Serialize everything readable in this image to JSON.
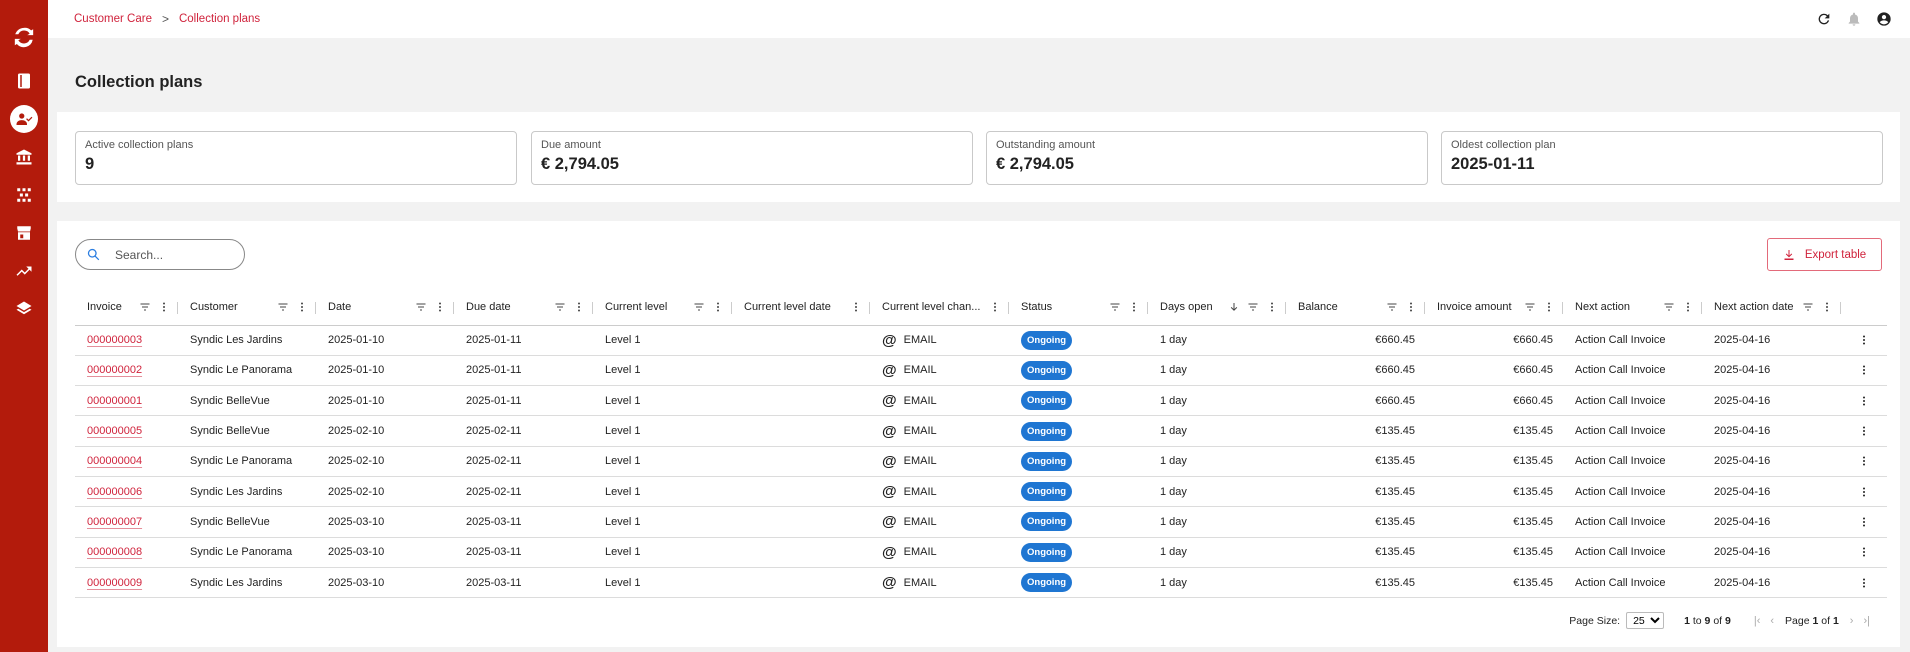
{
  "breadcrumb": {
    "parent": "Customer Care",
    "separator": ">",
    "current": "Collection plans"
  },
  "page": {
    "title": "Collection plans"
  },
  "kpis": [
    {
      "label": "Active collection plans",
      "value": "9"
    },
    {
      "label": "Due amount",
      "value": "€ 2,794.05"
    },
    {
      "label": "Outstanding amount",
      "value": "€ 2,794.05"
    },
    {
      "label": "Oldest collection plan",
      "value": "2025-01-11"
    }
  ],
  "search": {
    "placeholder": "Search..."
  },
  "export": {
    "label": "Export table"
  },
  "table": {
    "headers": [
      "Invoice",
      "Customer",
      "Date",
      "Due date",
      "Current level",
      "Current level date",
      "Current level chan...",
      "Status",
      "Days open",
      "Balance",
      "Invoice amount",
      "Next action",
      "Next action date"
    ],
    "rows": [
      {
        "invoice": "000000003",
        "customer": "Syndic Les Jardins",
        "date": "2025-01-10",
        "due": "2025-01-11",
        "level": "Level 1",
        "level_date": "",
        "channel": "EMAIL",
        "status": "Ongoing",
        "days": "1 day",
        "balance": "€660.45",
        "amount": "€660.45",
        "next_action": "Action Call Invoice",
        "next_date": "2025-04-16"
      },
      {
        "invoice": "000000002",
        "customer": "Syndic Le Panorama",
        "date": "2025-01-10",
        "due": "2025-01-11",
        "level": "Level 1",
        "level_date": "",
        "channel": "EMAIL",
        "status": "Ongoing",
        "days": "1 day",
        "balance": "€660.45",
        "amount": "€660.45",
        "next_action": "Action Call Invoice",
        "next_date": "2025-04-16"
      },
      {
        "invoice": "000000001",
        "customer": "Syndic BelleVue",
        "date": "2025-01-10",
        "due": "2025-01-11",
        "level": "Level 1",
        "level_date": "",
        "channel": "EMAIL",
        "status": "Ongoing",
        "days": "1 day",
        "balance": "€660.45",
        "amount": "€660.45",
        "next_action": "Action Call Invoice",
        "next_date": "2025-04-16"
      },
      {
        "invoice": "000000005",
        "customer": "Syndic BelleVue",
        "date": "2025-02-10",
        "due": "2025-02-11",
        "level": "Level 1",
        "level_date": "",
        "channel": "EMAIL",
        "status": "Ongoing",
        "days": "1 day",
        "balance": "€135.45",
        "amount": "€135.45",
        "next_action": "Action Call Invoice",
        "next_date": "2025-04-16"
      },
      {
        "invoice": "000000004",
        "customer": "Syndic Le Panorama",
        "date": "2025-02-10",
        "due": "2025-02-11",
        "level": "Level 1",
        "level_date": "",
        "channel": "EMAIL",
        "status": "Ongoing",
        "days": "1 day",
        "balance": "€135.45",
        "amount": "€135.45",
        "next_action": "Action Call Invoice",
        "next_date": "2025-04-16"
      },
      {
        "invoice": "000000006",
        "customer": "Syndic Les Jardins",
        "date": "2025-02-10",
        "due": "2025-02-11",
        "level": "Level 1",
        "level_date": "",
        "channel": "EMAIL",
        "status": "Ongoing",
        "days": "1 day",
        "balance": "€135.45",
        "amount": "€135.45",
        "next_action": "Action Call Invoice",
        "next_date": "2025-04-16"
      },
      {
        "invoice": "000000007",
        "customer": "Syndic BelleVue",
        "date": "2025-03-10",
        "due": "2025-03-11",
        "level": "Level 1",
        "level_date": "",
        "channel": "EMAIL",
        "status": "Ongoing",
        "days": "1 day",
        "balance": "€135.45",
        "amount": "€135.45",
        "next_action": "Action Call Invoice",
        "next_date": "2025-04-16"
      },
      {
        "invoice": "000000008",
        "customer": "Syndic Le Panorama",
        "date": "2025-03-10",
        "due": "2025-03-11",
        "level": "Level 1",
        "level_date": "",
        "channel": "EMAIL",
        "status": "Ongoing",
        "days": "1 day",
        "balance": "€135.45",
        "amount": "€135.45",
        "next_action": "Action Call Invoice",
        "next_date": "2025-04-16"
      },
      {
        "invoice": "000000009",
        "customer": "Syndic Les Jardins",
        "date": "2025-03-10",
        "due": "2025-03-11",
        "level": "Level 1",
        "level_date": "",
        "channel": "EMAIL",
        "status": "Ongoing",
        "days": "1 day",
        "balance": "€135.45",
        "amount": "€135.45",
        "next_action": "Action Call Invoice",
        "next_date": "2025-04-16"
      }
    ]
  },
  "pagination": {
    "page_size_label": "Page Size:",
    "page_size": "25",
    "range_from": "1",
    "range_to_label": "to",
    "range_to": "9",
    "of_label": "of",
    "total": "9",
    "page_label": "Page",
    "page": "1",
    "page_of_label": "of",
    "page_total": "1"
  },
  "colors": {
    "sidebar": "#b31b0c",
    "accent": "#d0233c",
    "status_badge": "#1f76d2"
  },
  "icons": {
    "sidebar": [
      "app-logo-icon",
      "book-icon",
      "customer-care-icon",
      "bank-icon",
      "grid-dots-icon",
      "store-icon",
      "trending-up-icon",
      "layers-icon"
    ],
    "topbar": [
      "refresh-icon",
      "bell-icon",
      "account-icon"
    ]
  }
}
